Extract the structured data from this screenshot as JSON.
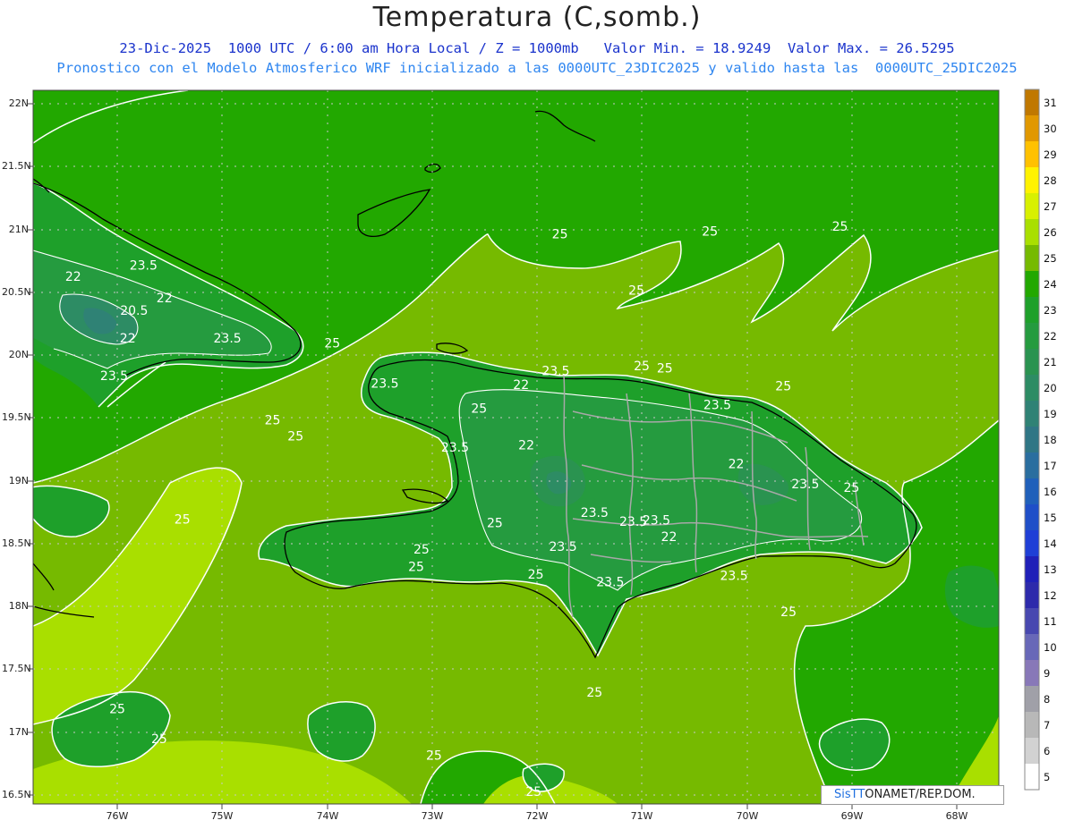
{
  "header": {
    "title": "Temperatura (C,somb.)",
    "subtitle1": "23-Dic-2025  1000 UTC / 6:00 am Hora Local / Z = 1000mb   Valor Min. = 18.9249  Valor Max. = 26.5295",
    "subtitle2": "Pronostico con el Modelo Atmosferico WRF inicializado a las 0000UTC_23DIC2025 y valido hasta las  0000UTC_25DIC2025"
  },
  "axes": {
    "lat_labels": [
      "22N",
      "21.5N",
      "21N",
      "20.5N",
      "20N",
      "19.5N",
      "19N",
      "18.5N",
      "18N",
      "17.5N",
      "17N",
      "16.5N"
    ],
    "lon_labels": [
      "76W",
      "75W",
      "74W",
      "73W",
      "72W",
      "71W",
      "70W",
      "69W",
      "68W"
    ]
  },
  "colorbar": {
    "levels": [
      "31",
      "30",
      "29",
      "28",
      "27",
      "26",
      "25",
      "24",
      "23",
      "22",
      "21",
      "20",
      "19",
      "18",
      "17",
      "16",
      "15",
      "14",
      "13",
      "12",
      "11",
      "10",
      "9",
      "8",
      "7",
      "6",
      "5"
    ],
    "colors": [
      "#c07800",
      "#e19800",
      "#ffc100",
      "#fff200",
      "#d8f000",
      "#a9df00",
      "#76ba00",
      "#22a800",
      "#1ea02a",
      "#259b3f",
      "#2a9350",
      "#2d8c64",
      "#2f8275",
      "#2f7685",
      "#2a6e9f",
      "#2060ba",
      "#1f4fc8",
      "#1f3fd6",
      "#2020b8",
      "#2d2aab",
      "#4848b0",
      "#6868b8",
      "#8878b8",
      "#a0a0a8",
      "#b8b8b8",
      "#d2d2d2",
      "#ffffff"
    ]
  },
  "contour_labels": [
    {
      "text": "25",
      "lon": -73.95,
      "lat": 20.06
    },
    {
      "text": "25",
      "lon": -71.78,
      "lat": 20.93
    },
    {
      "text": "25",
      "lon": -71.05,
      "lat": 20.48
    },
    {
      "text": "25",
      "lon": -70.35,
      "lat": 20.95
    },
    {
      "text": "25",
      "lon": -69.11,
      "lat": 20.99
    },
    {
      "text": "25",
      "lon": -70.78,
      "lat": 19.86
    },
    {
      "text": "25",
      "lon": -71.0,
      "lat": 19.88
    },
    {
      "text": "25",
      "lon": -69.65,
      "lat": 19.72
    },
    {
      "text": "25",
      "lon": -72.55,
      "lat": 19.54
    },
    {
      "text": "25",
      "lon": -74.52,
      "lat": 19.45
    },
    {
      "text": "25",
      "lon": -74.3,
      "lat": 19.32
    },
    {
      "text": "25",
      "lon": -75.38,
      "lat": 18.66
    },
    {
      "text": "25",
      "lon": -73.1,
      "lat": 18.42
    },
    {
      "text": "25",
      "lon": -73.15,
      "lat": 18.28
    },
    {
      "text": "25",
      "lon": -72.4,
      "lat": 18.63
    },
    {
      "text": "25",
      "lon": -72.01,
      "lat": 18.22
    },
    {
      "text": "25",
      "lon": -69.6,
      "lat": 17.92
    },
    {
      "text": "25",
      "lon": -71.45,
      "lat": 17.28
    },
    {
      "text": "25",
      "lon": -76.0,
      "lat": 17.15
    },
    {
      "text": "25",
      "lon": -75.6,
      "lat": 16.91
    },
    {
      "text": "25",
      "lon": -72.98,
      "lat": 16.78
    },
    {
      "text": "25",
      "lon": -72.03,
      "lat": 16.49
    },
    {
      "text": "25",
      "lon": -69.0,
      "lat": 18.91
    },
    {
      "text": "23.5",
      "lon": -75.75,
      "lat": 20.68
    },
    {
      "text": "23.5",
      "lon": -74.95,
      "lat": 20.1
    },
    {
      "text": "23.5",
      "lon": -76.03,
      "lat": 19.8
    },
    {
      "text": "23.5",
      "lon": -73.45,
      "lat": 19.74
    },
    {
      "text": "23.5",
      "lon": -71.82,
      "lat": 19.84
    },
    {
      "text": "23.5",
      "lon": -72.78,
      "lat": 19.23
    },
    {
      "text": "23.5",
      "lon": -71.45,
      "lat": 18.71
    },
    {
      "text": "23.5",
      "lon": -71.08,
      "lat": 18.64
    },
    {
      "text": "23.5",
      "lon": -70.86,
      "lat": 18.65
    },
    {
      "text": "23.5",
      "lon": -71.75,
      "lat": 18.44
    },
    {
      "text": "23.5",
      "lon": -71.3,
      "lat": 18.16
    },
    {
      "text": "23.5",
      "lon": -70.12,
      "lat": 18.21
    },
    {
      "text": "23.5",
      "lon": -70.28,
      "lat": 19.57
    },
    {
      "text": "23.5",
      "lon": -69.44,
      "lat": 18.94
    },
    {
      "text": "22",
      "lon": -76.42,
      "lat": 20.59
    },
    {
      "text": "22",
      "lon": -75.55,
      "lat": 20.42
    },
    {
      "text": "22",
      "lon": -75.9,
      "lat": 20.1
    },
    {
      "text": "22",
      "lon": -72.15,
      "lat": 19.73
    },
    {
      "text": "22",
      "lon": -72.1,
      "lat": 19.25
    },
    {
      "text": "22",
      "lon": -70.1,
      "lat": 19.1
    },
    {
      "text": "22",
      "lon": -70.74,
      "lat": 18.52
    },
    {
      "text": "20.5",
      "lon": -75.84,
      "lat": 20.32
    }
  ],
  "credit": {
    "part1": "SisTT",
    "part2": "ONAMET/REP.DOM."
  }
}
